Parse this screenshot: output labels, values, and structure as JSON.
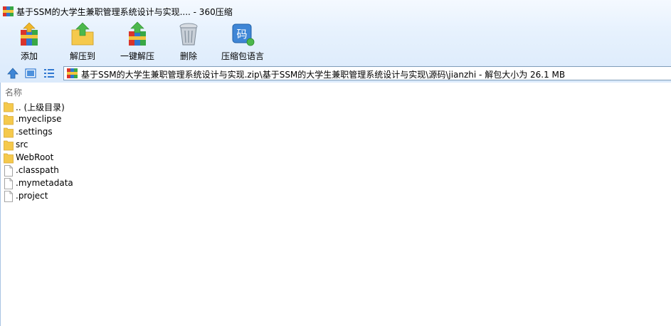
{
  "window": {
    "title": "基于SSM的大学生兼职管理系统设计与实现.... - 360压缩"
  },
  "toolbar": {
    "buttons": [
      {
        "label": "添加",
        "icon": "add-archive-icon"
      },
      {
        "label": "解压到",
        "icon": "extract-to-icon"
      },
      {
        "label": "一键解压",
        "icon": "one-click-extract-icon"
      },
      {
        "label": "删除",
        "icon": "delete-trash-icon"
      },
      {
        "label": "压缩包语言",
        "icon": "archive-language-icon"
      }
    ]
  },
  "address": {
    "path": "基于SSM的大学生兼职管理系统设计与实现.zip\\基于SSM的大学生兼职管理系统设计与实现\\源码\\jianzhi - 解包大小为 26.1 MB"
  },
  "filelist": {
    "column_name": "名称",
    "items": [
      {
        "name": ".. (上级目录)",
        "type": "folder"
      },
      {
        "name": ".myeclipse",
        "type": "folder"
      },
      {
        "name": ".settings",
        "type": "folder"
      },
      {
        "name": "src",
        "type": "folder"
      },
      {
        "name": "WebRoot",
        "type": "folder"
      },
      {
        "name": ".classpath",
        "type": "file"
      },
      {
        "name": ".mymetadata",
        "type": "file"
      },
      {
        "name": ".project",
        "type": "file"
      }
    ]
  },
  "colors": {
    "chrome": "#dbeafb",
    "folder": "#f5c94c",
    "accent": "#2f77d0"
  }
}
